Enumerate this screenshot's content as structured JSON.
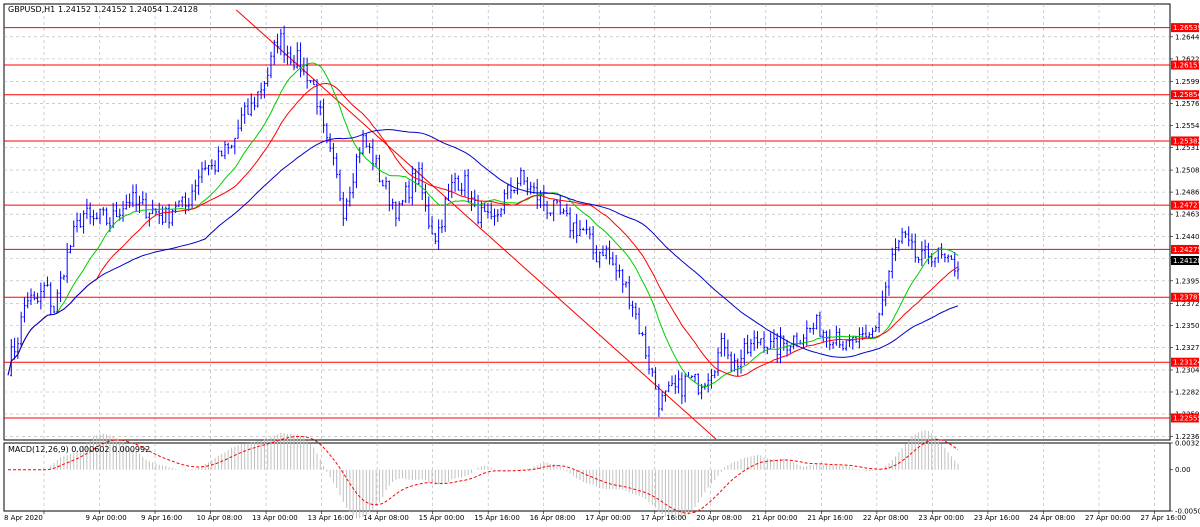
{
  "header": {
    "symbol": "GBPUSD,H1",
    "ohlc": "1.24152 1.24152 1.24054 1.24128"
  },
  "chart_data": [
    {
      "type": "candlestick",
      "title": "GBPUSD,H1",
      "grid": true,
      "ylim": [
        1.2233,
        1.2678
      ],
      "y_ticks": [
        "1.26445",
        "1.26220",
        "1.25990",
        "1.25765",
        "1.25540",
        "1.25315",
        "1.25085",
        "1.24860",
        "1.24635",
        "1.24405",
        "1.24180",
        "1.23955",
        "1.23725",
        "1.23500",
        "1.23275",
        "1.23045",
        "1.22820",
        "1.22595",
        "1.22365"
      ],
      "x_ticks": [
        "8 Apr 2020",
        "9 Apr 00:00",
        "9 Apr 16:00",
        "10 Apr 08:00",
        "13 Apr 00:00",
        "13 Apr 16:00",
        "14 Apr 08:00",
        "15 Apr 00:00",
        "15 Apr 16:00",
        "16 Apr 08:00",
        "17 Apr 00:00",
        "17 Apr 16:00",
        "20 Apr 08:00",
        "21 Apr 00:00",
        "21 Apr 16:00",
        "22 Apr 08:00",
        "23 Apr 00:00",
        "23 Apr 16:00",
        "24 Apr 08:00",
        "27 Apr 00:00",
        "27 Apr 16:00"
      ],
      "horizontal_levels": [
        "1.26539",
        "1.26157",
        "1.25854",
        "1.25382",
        "1.24727",
        "1.24275",
        "1.23787",
        "1.23124",
        "1.22555"
      ],
      "current_price": "1.24128",
      "price_path": [
        {
          "t": 0.0,
          "p": 1.231
        },
        {
          "t": 1.0,
          "p": 1.2335
        },
        {
          "t": 2.0,
          "p": 1.238
        },
        {
          "t": 3.0,
          "p": 1.237
        },
        {
          "t": 4.0,
          "p": 1.239
        },
        {
          "t": 5.0,
          "p": 1.2365
        },
        {
          "t": 6.0,
          "p": 1.241
        },
        {
          "t": 7.0,
          "p": 1.244
        },
        {
          "t": 8.0,
          "p": 1.2465
        },
        {
          "t": 9.0,
          "p": 1.2455
        },
        {
          "t": 10.0,
          "p": 1.246
        },
        {
          "t": 11.0,
          "p": 1.2455
        },
        {
          "t": 12.0,
          "p": 1.247
        },
        {
          "t": 13.0,
          "p": 1.248
        },
        {
          "t": 14.0,
          "p": 1.247
        },
        {
          "t": 15.0,
          "p": 1.247
        },
        {
          "t": 16.0,
          "p": 1.2465
        },
        {
          "t": 17.0,
          "p": 1.246
        },
        {
          "t": 18.0,
          "p": 1.2475
        },
        {
          "t": 19.0,
          "p": 1.247
        },
        {
          "t": 20.0,
          "p": 1.2495
        },
        {
          "t": 21.0,
          "p": 1.2515
        },
        {
          "t": 22.0,
          "p": 1.251
        },
        {
          "t": 23.0,
          "p": 1.2525
        },
        {
          "t": 24.0,
          "p": 1.253
        },
        {
          "t": 25.0,
          "p": 1.256
        },
        {
          "t": 26.0,
          "p": 1.257
        },
        {
          "t": 27.0,
          "p": 1.259
        },
        {
          "t": 28.0,
          "p": 1.261
        },
        {
          "t": 29.0,
          "p": 1.2645
        },
        {
          "t": 30.0,
          "p": 1.263
        },
        {
          "t": 31.0,
          "p": 1.262
        },
        {
          "t": 32.0,
          "p": 1.261
        },
        {
          "t": 33.0,
          "p": 1.259
        },
        {
          "t": 34.0,
          "p": 1.254
        },
        {
          "t": 35.0,
          "p": 1.251
        },
        {
          "t": 36.0,
          "p": 1.247
        },
        {
          "t": 37.0,
          "p": 1.2505
        },
        {
          "t": 38.0,
          "p": 1.254
        },
        {
          "t": 39.0,
          "p": 1.2525
        },
        {
          "t": 40.0,
          "p": 1.25
        },
        {
          "t": 41.0,
          "p": 1.248
        },
        {
          "t": 42.0,
          "p": 1.2465
        },
        {
          "t": 43.0,
          "p": 1.249
        },
        {
          "t": 44.0,
          "p": 1.2505
        },
        {
          "t": 45.0,
          "p": 1.246
        },
        {
          "t": 46.0,
          "p": 1.244
        },
        {
          "t": 47.0,
          "p": 1.2475
        },
        {
          "t": 48.0,
          "p": 1.25
        },
        {
          "t": 49.0,
          "p": 1.2495
        },
        {
          "t": 50.0,
          "p": 1.247
        },
        {
          "t": 51.0,
          "p": 1.246
        },
        {
          "t": 52.0,
          "p": 1.245
        },
        {
          "t": 53.0,
          "p": 1.2475
        },
        {
          "t": 54.0,
          "p": 1.249
        },
        {
          "t": 55.0,
          "p": 1.25
        },
        {
          "t": 56.0,
          "p": 1.249
        },
        {
          "t": 57.0,
          "p": 1.248
        },
        {
          "t": 58.0,
          "p": 1.247
        },
        {
          "t": 59.0,
          "p": 1.2465
        },
        {
          "t": 60.0,
          "p": 1.2455
        },
        {
          "t": 61.0,
          "p": 1.245
        },
        {
          "t": 62.0,
          "p": 1.2445
        },
        {
          "t": 63.0,
          "p": 1.242
        },
        {
          "t": 64.0,
          "p": 1.243
        },
        {
          "t": 65.0,
          "p": 1.241
        },
        {
          "t": 66.0,
          "p": 1.2395
        },
        {
          "t": 67.0,
          "p": 1.2375
        },
        {
          "t": 68.0,
          "p": 1.234
        },
        {
          "t": 69.0,
          "p": 1.2305
        },
        {
          "t": 70.0,
          "p": 1.227
        },
        {
          "t": 71.0,
          "p": 1.228
        },
        {
          "t": 72.0,
          "p": 1.2285
        },
        {
          "t": 73.0,
          "p": 1.2295
        },
        {
          "t": 74.0,
          "p": 1.229
        },
        {
          "t": 75.0,
          "p": 1.23
        },
        {
          "t": 76.0,
          "p": 1.2315
        },
        {
          "t": 77.0,
          "p": 1.2335
        },
        {
          "t": 78.0,
          "p": 1.231
        },
        {
          "t": 79.0,
          "p": 1.232
        },
        {
          "t": 80.0,
          "p": 1.233
        },
        {
          "t": 81.0,
          "p": 1.234
        },
        {
          "t": 82.0,
          "p": 1.2325
        },
        {
          "t": 83.0,
          "p": 1.233
        },
        {
          "t": 84.0,
          "p": 1.2335
        },
        {
          "t": 85.0,
          "p": 1.234
        },
        {
          "t": 86.0,
          "p": 1.2345
        },
        {
          "t": 87.0,
          "p": 1.235
        },
        {
          "t": 88.0,
          "p": 1.234
        },
        {
          "t": 89.0,
          "p": 1.2345
        },
        {
          "t": 90.0,
          "p": 1.2325
        },
        {
          "t": 91.0,
          "p": 1.2335
        },
        {
          "t": 92.0,
          "p": 1.233
        },
        {
          "t": 93.0,
          "p": 1.2345
        },
        {
          "t": 94.0,
          "p": 1.238
        },
        {
          "t": 95.0,
          "p": 1.242
        },
        {
          "t": 96.0,
          "p": 1.244
        },
        {
          "t": 97.0,
          "p": 1.2425
        },
        {
          "t": 98.0,
          "p": 1.2415
        },
        {
          "t": 99.0,
          "p": 1.2425
        },
        {
          "t": 100.0,
          "p": 1.242
        },
        {
          "t": 101.0,
          "p": 1.241
        },
        {
          "t": 102.0,
          "p": 1.2413
        }
      ],
      "moving_averages": [
        {
          "color": "#00cc00",
          "period": 5
        },
        {
          "color": "#ff0000",
          "period": 9
        },
        {
          "color": "#0000cc",
          "period": 20
        }
      ],
      "trendline_color": "#ff0000",
      "candle_color": "#0000ff"
    },
    {
      "type": "bar",
      "title": "MACD(12,26,9) 0.000602 0.000992",
      "y_ticks": [
        "0.003236",
        "0.00",
        "-0.0050"
      ],
      "ylim": [
        -0.005,
        0.003236
      ],
      "signal_color": "#ff0000",
      "histogram_color": "#c0c0c0"
    }
  ]
}
